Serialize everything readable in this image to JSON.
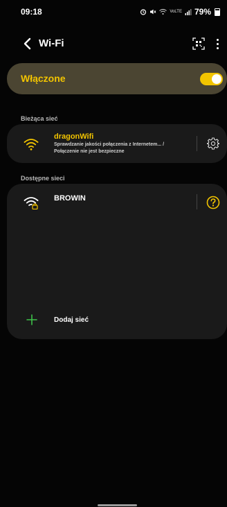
{
  "status_bar": {
    "time": "09:18",
    "alarm_icon": "alarm-icon",
    "mute_icon": "mute-icon",
    "wifi_icon": "wifi-status-icon",
    "volte_text": "VoLTE",
    "signal_icon": "signal-icon",
    "battery_text": "79%",
    "battery_icon": "battery-icon"
  },
  "app_bar": {
    "title": "Wi-Fi",
    "back_icon": "back-arrow-icon",
    "qr_icon": "qr-code-scan-icon",
    "more_icon": "more-vert-icon"
  },
  "master_toggle": {
    "label": "Włączone",
    "state": "on"
  },
  "current_network": {
    "section_label": "Bieżąca sieć",
    "name": "dragonWifi",
    "status_line1": "Sprawdzanie jakości połączenia z Internetem... /",
    "status_line2": "Połączenie nie jest bezpieczne",
    "wifi_icon": "wifi-icon",
    "settings_icon": "gear-icon"
  },
  "available_networks": {
    "section_label": "Dostępne sieci",
    "items": [
      {
        "name": "BROWIN",
        "wifi_icon": "wifi-lock-icon",
        "info_icon": "question-icon"
      }
    ],
    "add_label": "Dodaj sieć",
    "add_icon": "plus-icon"
  },
  "colors": {
    "accent": "#f2c400",
    "add_accent": "#3ec14a",
    "card_bg": "#1a1a1a",
    "toggle_card_bg": "#4b4532",
    "background": "#050505"
  }
}
